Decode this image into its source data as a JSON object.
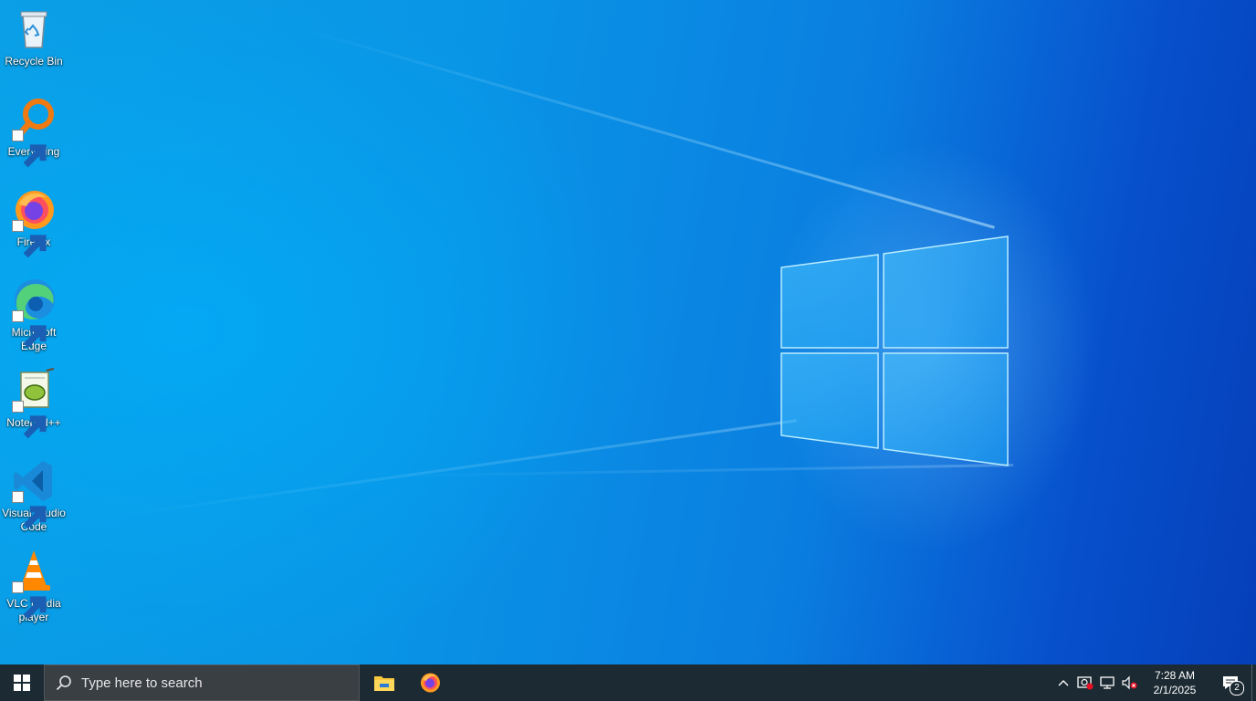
{
  "desktop": {
    "icons": [
      {
        "label": "Recycle Bin",
        "icon": "recycle-bin-icon",
        "shortcut": false
      },
      {
        "label": "Everything",
        "icon": "everything-search-icon",
        "shortcut": true
      },
      {
        "label": "Firefox",
        "icon": "firefox-icon",
        "shortcut": true
      },
      {
        "label": "Microsoft Edge",
        "icon": "edge-icon",
        "shortcut": true
      },
      {
        "label": "Notepad++",
        "icon": "notepad-plus-plus-icon",
        "shortcut": true
      },
      {
        "label": "Visual Studio Code",
        "icon": "vscode-icon",
        "shortcut": true
      },
      {
        "label": "VLC media player",
        "icon": "vlc-icon",
        "shortcut": true
      }
    ]
  },
  "taskbar": {
    "search_placeholder": "Type here to search",
    "pinned": [
      {
        "name": "File Explorer",
        "icon": "file-explorer-icon"
      },
      {
        "name": "Firefox",
        "icon": "firefox-icon"
      }
    ],
    "tray": {
      "time": "7:28 AM",
      "date": "2/1/2025",
      "notification_count": "2"
    }
  },
  "colors": {
    "wallpaper_accent": "#0a9fe6",
    "taskbar_bg": "#1c2a33",
    "search_bg": "#3a3f44"
  }
}
